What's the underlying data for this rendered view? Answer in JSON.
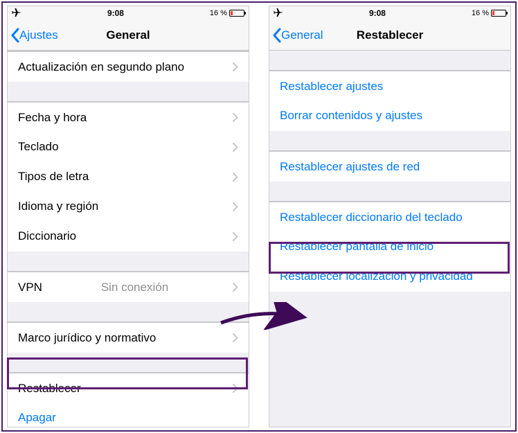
{
  "statusbar": {
    "time": "9:08",
    "battery_pct": "16 %"
  },
  "left_screen": {
    "back_label": "Ajustes",
    "title": "General",
    "rows": {
      "bg_update": "Actualización en segundo plano",
      "date_time": "Fecha y hora",
      "keyboard": "Teclado",
      "fonts": "Tipos de letra",
      "lang_region": "Idioma y región",
      "dictionary": "Diccionario",
      "vpn": "VPN",
      "vpn_detail": "Sin conexión",
      "legal": "Marco jurídico y normativo",
      "reset": "Restablecer",
      "shutdown": "Apagar"
    }
  },
  "right_screen": {
    "back_label": "General",
    "title": "Restablecer",
    "rows": {
      "reset_settings": "Restablecer ajustes",
      "erase_all": "Borrar contenidos y ajustes",
      "reset_network": "Restablecer ajustes de red",
      "reset_keyboard_dict": "Restablecer diccionario del teclado",
      "reset_home": "Restablecer pantalla de inicio",
      "reset_location_privacy": "Restablecer localización y privacidad"
    }
  }
}
